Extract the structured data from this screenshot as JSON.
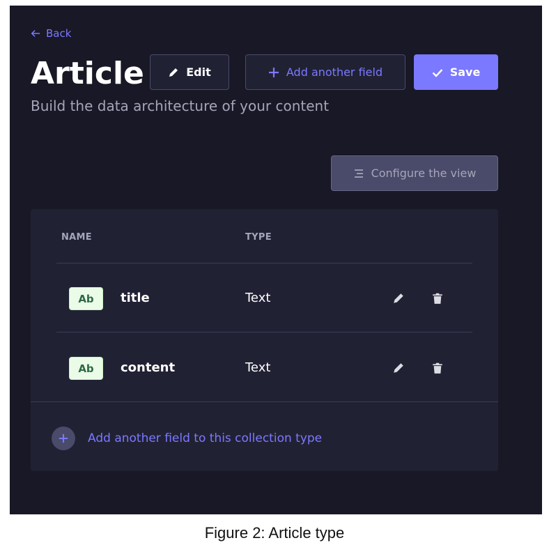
{
  "header": {
    "back_label": "Back",
    "title": "Article",
    "subtitle": "Build the data architecture of your content",
    "edit_label": "Edit",
    "add_field_label": "Add another field",
    "save_label": "Save"
  },
  "toolbar": {
    "configure_label": "Configure the view"
  },
  "table": {
    "columns": [
      "NAME",
      "TYPE"
    ],
    "rows": [
      {
        "badge": "Ab",
        "name": "title",
        "type": "Text"
      },
      {
        "badge": "Ab",
        "name": "content",
        "type": "Text"
      }
    ],
    "add_field_footer": "Add another field to this collection type"
  },
  "caption": "Figure 2: Article type",
  "icons": {
    "back": "arrow-left-icon",
    "edit": "pencil-icon",
    "add": "plus-icon",
    "save": "check-icon",
    "configure": "layout-lines-icon",
    "row_edit": "pencil-icon",
    "row_delete": "trash-icon"
  },
  "colors": {
    "background": "#181826",
    "card": "#212134",
    "primary": "#7b79ff",
    "badge_bg": "#eafbe7",
    "badge_text": "#2f6846"
  }
}
